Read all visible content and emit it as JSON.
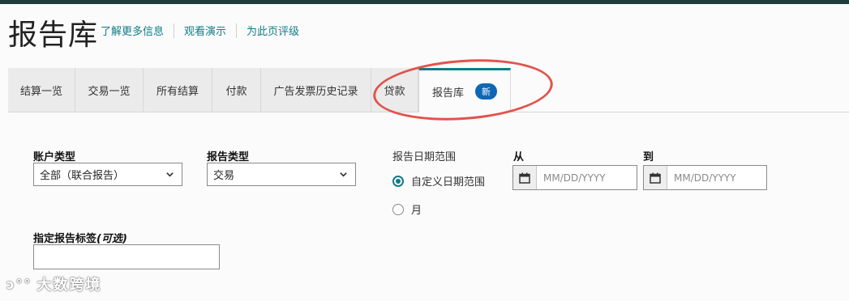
{
  "page": {
    "title": "报告库",
    "links": [
      "了解更多信息",
      "观看演示",
      "为此页评级"
    ]
  },
  "tabs": [
    {
      "label": "结算一览"
    },
    {
      "label": "交易一览"
    },
    {
      "label": "所有结算"
    },
    {
      "label": "付款"
    },
    {
      "label": "广告发票历史记录"
    },
    {
      "label": "贷款"
    },
    {
      "label": "报告库",
      "badge": "新",
      "active": true
    }
  ],
  "form": {
    "account_type": {
      "label": "账户类型",
      "value": "全部（联合报告）"
    },
    "report_type": {
      "label": "报告类型",
      "value": "交易"
    },
    "date_range": {
      "label": "报告日期范围",
      "options": [
        {
          "label": "自定义日期范围",
          "selected": true
        },
        {
          "label": "月",
          "selected": false
        }
      ]
    },
    "from": {
      "label": "从",
      "placeholder": "MM/DD/YYYY"
    },
    "to": {
      "label": "到",
      "placeholder": "MM/DD/YYYY"
    },
    "tag": {
      "label": "指定报告标签",
      "optional": "(可选)"
    }
  },
  "watermark": "大数跨境",
  "colors": {
    "accent": "#0f7c86",
    "badge": "#0e67b5",
    "annotation": "#e2534d"
  },
  "icons": [
    "calendar-icon",
    "chevron-down-icon"
  ]
}
